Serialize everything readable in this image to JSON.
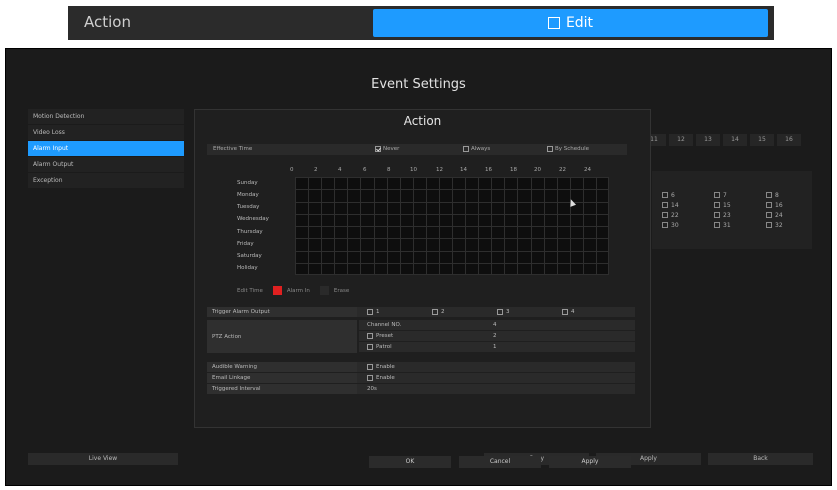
{
  "top": {
    "title": "Action",
    "edit_label": "Edit"
  },
  "screen": {
    "title": "Event Settings"
  },
  "left_menu": [
    {
      "label": "Motion Detection",
      "active": false
    },
    {
      "label": "Video Loss",
      "active": false
    },
    {
      "label": "Alarm Input",
      "active": true
    },
    {
      "label": "Alarm Output",
      "active": false
    },
    {
      "label": "Exception",
      "active": false
    }
  ],
  "bg_numbers": [
    "11",
    "12",
    "13",
    "14",
    "15",
    "16"
  ],
  "bg_checks": [
    "6",
    "7",
    "8",
    "14",
    "15",
    "16",
    "22",
    "23",
    "24",
    "30",
    "31",
    "32"
  ],
  "bottom_buttons": {
    "live_view": "Live View",
    "copy": "Copy",
    "apply": "Apply",
    "back": "Back"
  },
  "dialog": {
    "title": "Action",
    "effective_time": {
      "label": "Effective Time",
      "options": [
        {
          "label": "Never",
          "checked": true
        },
        {
          "label": "Always",
          "checked": false
        },
        {
          "label": "By Schedule",
          "checked": false
        }
      ]
    },
    "hours": [
      "0",
      "2",
      "4",
      "6",
      "8",
      "10",
      "12",
      "14",
      "16",
      "18",
      "20",
      "22",
      "24"
    ],
    "days": [
      "Sunday",
      "Monday",
      "Tuesday",
      "Wednesday",
      "Thursday",
      "Friday",
      "Saturday",
      "Holiday"
    ],
    "legend": {
      "edit_time": "Edit Time",
      "alarm_in": "Alarm In",
      "erase": "Erase",
      "alarm_color": "#e02020",
      "erase_color": "#2a2a2a"
    },
    "trigger_alarm_output": {
      "label": "Trigger Alarm Output",
      "outputs": [
        "1",
        "2",
        "3",
        "4"
      ]
    },
    "ptz_action": {
      "label": "PTZ Action",
      "channel_label": "Channel NO.",
      "channel_value": "4",
      "preset_label": "Preset",
      "preset_value": "2",
      "patrol_label": "Patrol",
      "patrol_value": "1"
    },
    "audible_warning": {
      "label": "Audible Warning",
      "value": "Enable"
    },
    "email_linkage": {
      "label": "Email Linkage",
      "value": "Enable"
    },
    "triggered_interval": {
      "label": "Triggered Interval",
      "value": "20s"
    },
    "buttons": {
      "ok": "OK",
      "cancel": "Cancel",
      "apply": "Apply"
    }
  }
}
